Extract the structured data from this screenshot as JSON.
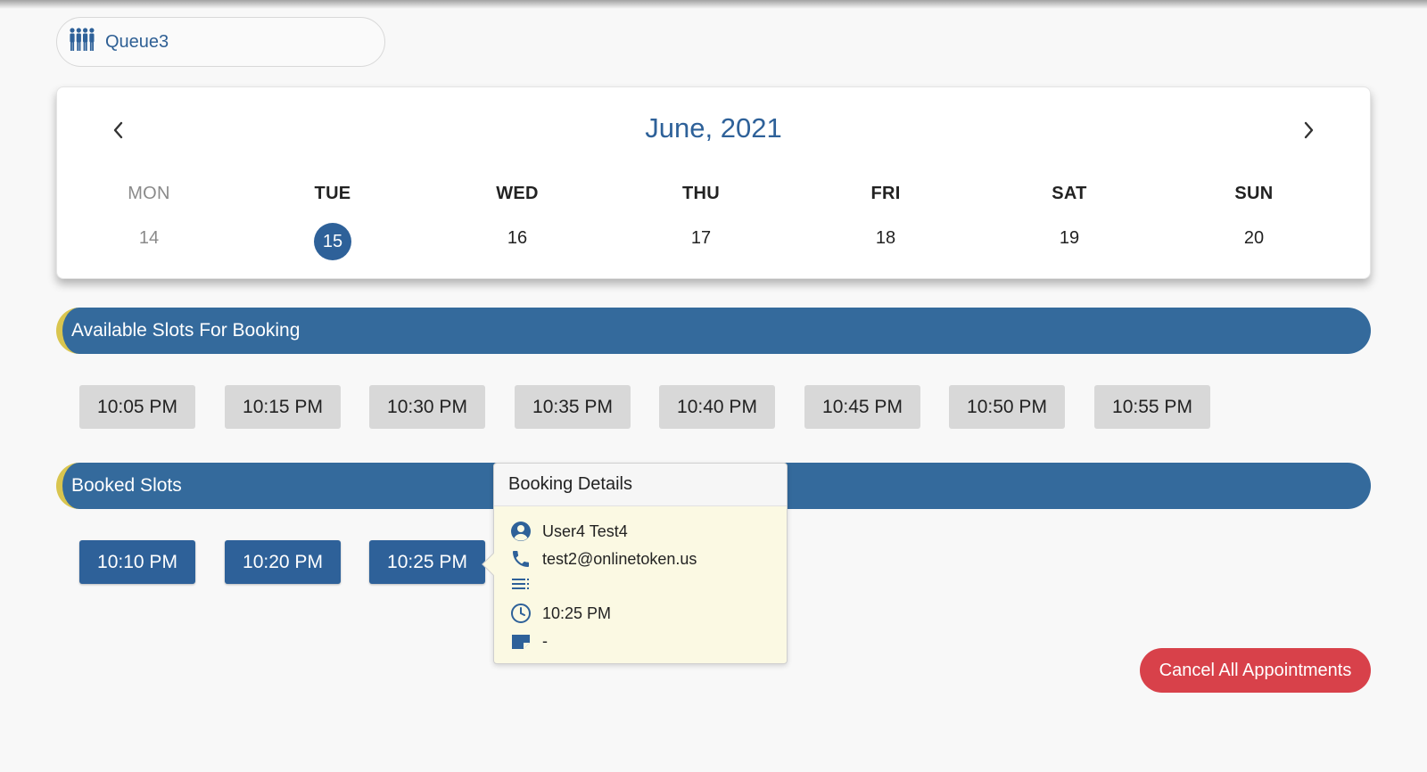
{
  "queue": {
    "name": "Queue3",
    "icon": "people-group-icon"
  },
  "calendar": {
    "month_label": "June, 2021",
    "prev_icon": "chevron-left-icon",
    "next_icon": "chevron-right-icon",
    "days": [
      {
        "name": "MON",
        "num": "14",
        "state": "past"
      },
      {
        "name": "TUE",
        "num": "15",
        "state": "selected"
      },
      {
        "name": "WED",
        "num": "16",
        "state": "normal"
      },
      {
        "name": "THU",
        "num": "17",
        "state": "normal"
      },
      {
        "name": "FRI",
        "num": "18",
        "state": "normal"
      },
      {
        "name": "SAT",
        "num": "19",
        "state": "normal"
      },
      {
        "name": "SUN",
        "num": "20",
        "state": "normal"
      }
    ]
  },
  "available": {
    "title": "Available Slots For Booking",
    "slots": [
      "10:05 PM",
      "10:15 PM",
      "10:30 PM",
      "10:35 PM",
      "10:40 PM",
      "10:45 PM",
      "10:50 PM",
      "10:55 PM"
    ]
  },
  "booked": {
    "title": "Booked Slots",
    "slots": [
      "10:10 PM",
      "10:20 PM",
      "10:25 PM"
    ]
  },
  "booking_details": {
    "title": "Booking Details",
    "name": "User4 Test4",
    "contact": "test2@onlinetoken.us",
    "notes": "",
    "time": "10:25 PM",
    "extra": "-"
  },
  "actions": {
    "cancel_all_label": "Cancel All Appointments"
  },
  "colors": {
    "primary": "#2e6199",
    "section_bar": "#346a9c",
    "accent": "#d9c54f",
    "danger": "#d8414a",
    "popover_bg": "#fbf9e3"
  }
}
